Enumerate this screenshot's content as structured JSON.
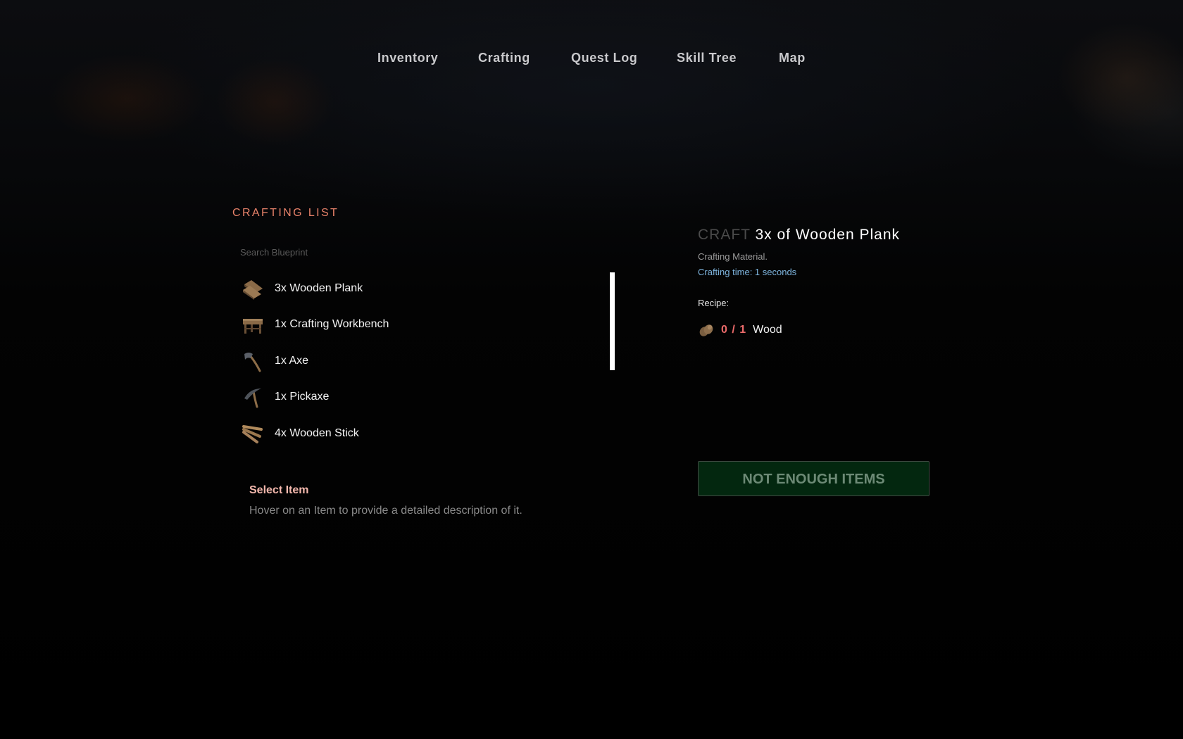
{
  "nav": {
    "items": [
      {
        "label": "Inventory",
        "icon": "none"
      },
      {
        "label": "Crafting",
        "icon": "none"
      },
      {
        "label": "Quest Log",
        "icon": "none"
      },
      {
        "label": "Skill Tree",
        "icon": "none"
      },
      {
        "label": "Map",
        "icon": "none"
      }
    ]
  },
  "crafting_list": {
    "title": "CRAFTING LIST",
    "search": {
      "value": "",
      "placeholder": "Search Blueprint"
    },
    "items": [
      {
        "label": "3x Wooden Plank",
        "icon": "wooden-plank-icon"
      },
      {
        "label": "1x Crafting Workbench",
        "icon": "workbench-icon"
      },
      {
        "label": "1x Axe",
        "icon": "axe-icon"
      },
      {
        "label": "1x Pickaxe",
        "icon": "pickaxe-icon"
      },
      {
        "label": "4x Wooden Stick",
        "icon": "wooden-stick-icon"
      }
    ]
  },
  "selection": {
    "title": "Select Item",
    "description": "Hover on an Item to provide a detailed description of it."
  },
  "craft_panel": {
    "prefix": "CRAFT",
    "name": "3x of Wooden Plank",
    "category": "Crafting Material.",
    "time": "Crafting time: 1 seconds",
    "recipe_label": "Recipe:",
    "recipe": [
      {
        "count": "0 / 1",
        "name": "Wood",
        "icon": "wood-log-icon",
        "have": 0,
        "need": 1
      }
    ],
    "button_label": "NOT ENOUGH ITEMS"
  },
  "colors": {
    "accent": "#e8826a",
    "select_title": "#f3b8ad",
    "info_blue": "#7fb6e0",
    "missing_red": "#ea6a6a",
    "button_bg": "#03270f",
    "button_text": "#6d8a76"
  }
}
